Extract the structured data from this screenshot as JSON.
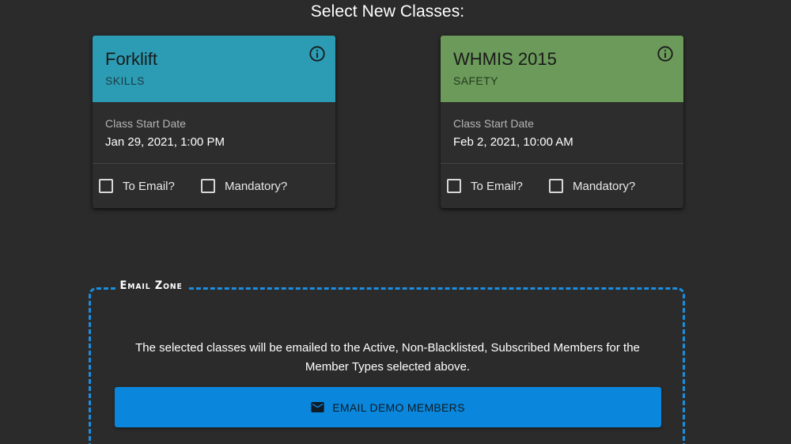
{
  "page": {
    "title": "Select New Classes:"
  },
  "classes": [
    {
      "title": "Forklift",
      "category": "SKILLS",
      "header_color": "#2b9cb4",
      "date_label": "Class Start Date",
      "date_value": "Jan 29, 2021, 1:00 PM",
      "to_email_label": "To Email?",
      "to_email_checked": false,
      "mandatory_label": "Mandatory?",
      "mandatory_checked": false,
      "info_icon": "info-circle-icon"
    },
    {
      "title": "WHMIS 2015",
      "category": "SAFETY",
      "header_color": "#6b9a5a",
      "date_label": "Class Start Date",
      "date_value": "Feb 2, 2021, 10:00 AM",
      "to_email_label": "To Email?",
      "to_email_checked": false,
      "mandatory_label": "Mandatory?",
      "mandatory_checked": false,
      "info_icon": "info-circle-icon"
    }
  ],
  "email_zone": {
    "legend": "Email Zone",
    "description": "The selected classes will be emailed to the Active, Non-Blacklisted, Subscribed Members for the Member Types selected above.",
    "button_label": "EMAIL DEMO MEMBERS",
    "button_icon": "mail-icon",
    "border_color": "#1a8ee0",
    "button_color": "#0a87dc"
  }
}
